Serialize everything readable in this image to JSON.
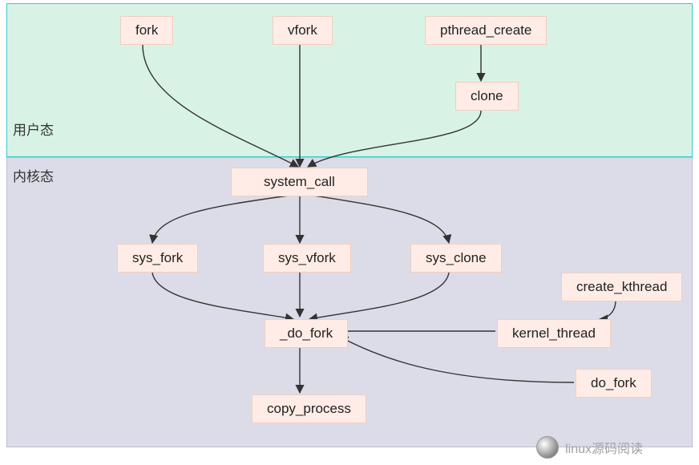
{
  "zones": {
    "user": {
      "label": "用户态"
    },
    "kernel": {
      "label": "内核态"
    }
  },
  "nodes": {
    "fork": {
      "label": "fork"
    },
    "vfork": {
      "label": "vfork"
    },
    "pthread_create": {
      "label": "pthread_create"
    },
    "clone": {
      "label": "clone"
    },
    "system_call": {
      "label": "system_call"
    },
    "sys_fork": {
      "label": "sys_fork"
    },
    "sys_vfork": {
      "label": "sys_vfork"
    },
    "sys_clone": {
      "label": "sys_clone"
    },
    "do_fork_internal": {
      "label": "_do_fork"
    },
    "create_kthread": {
      "label": "create_kthread"
    },
    "kernel_thread": {
      "label": "kernel_thread"
    },
    "do_fork": {
      "label": "do_fork"
    },
    "copy_process": {
      "label": "copy_process"
    }
  },
  "footer": {
    "label": "linux源码阅读"
  },
  "chart_data": {
    "type": "diagram",
    "title": "",
    "regions": [
      {
        "id": "user",
        "label": "用户态",
        "nodes": [
          "fork",
          "vfork",
          "pthread_create",
          "clone"
        ]
      },
      {
        "id": "kernel",
        "label": "内核态",
        "nodes": [
          "system_call",
          "sys_fork",
          "sys_vfork",
          "sys_clone",
          "_do_fork",
          "create_kthread",
          "kernel_thread",
          "do_fork",
          "copy_process"
        ]
      }
    ],
    "edges": [
      {
        "from": "fork",
        "to": "system_call"
      },
      {
        "from": "vfork",
        "to": "system_call"
      },
      {
        "from": "pthread_create",
        "to": "clone"
      },
      {
        "from": "clone",
        "to": "system_call"
      },
      {
        "from": "system_call",
        "to": "sys_fork"
      },
      {
        "from": "system_call",
        "to": "sys_vfork"
      },
      {
        "from": "system_call",
        "to": "sys_clone"
      },
      {
        "from": "sys_fork",
        "to": "_do_fork"
      },
      {
        "from": "sys_vfork",
        "to": "_do_fork"
      },
      {
        "from": "sys_clone",
        "to": "_do_fork"
      },
      {
        "from": "_do_fork",
        "to": "copy_process"
      },
      {
        "from": "create_kthread",
        "to": "kernel_thread"
      },
      {
        "from": "kernel_thread",
        "to": "_do_fork"
      },
      {
        "from": "do_fork",
        "to": "_do_fork"
      }
    ]
  }
}
